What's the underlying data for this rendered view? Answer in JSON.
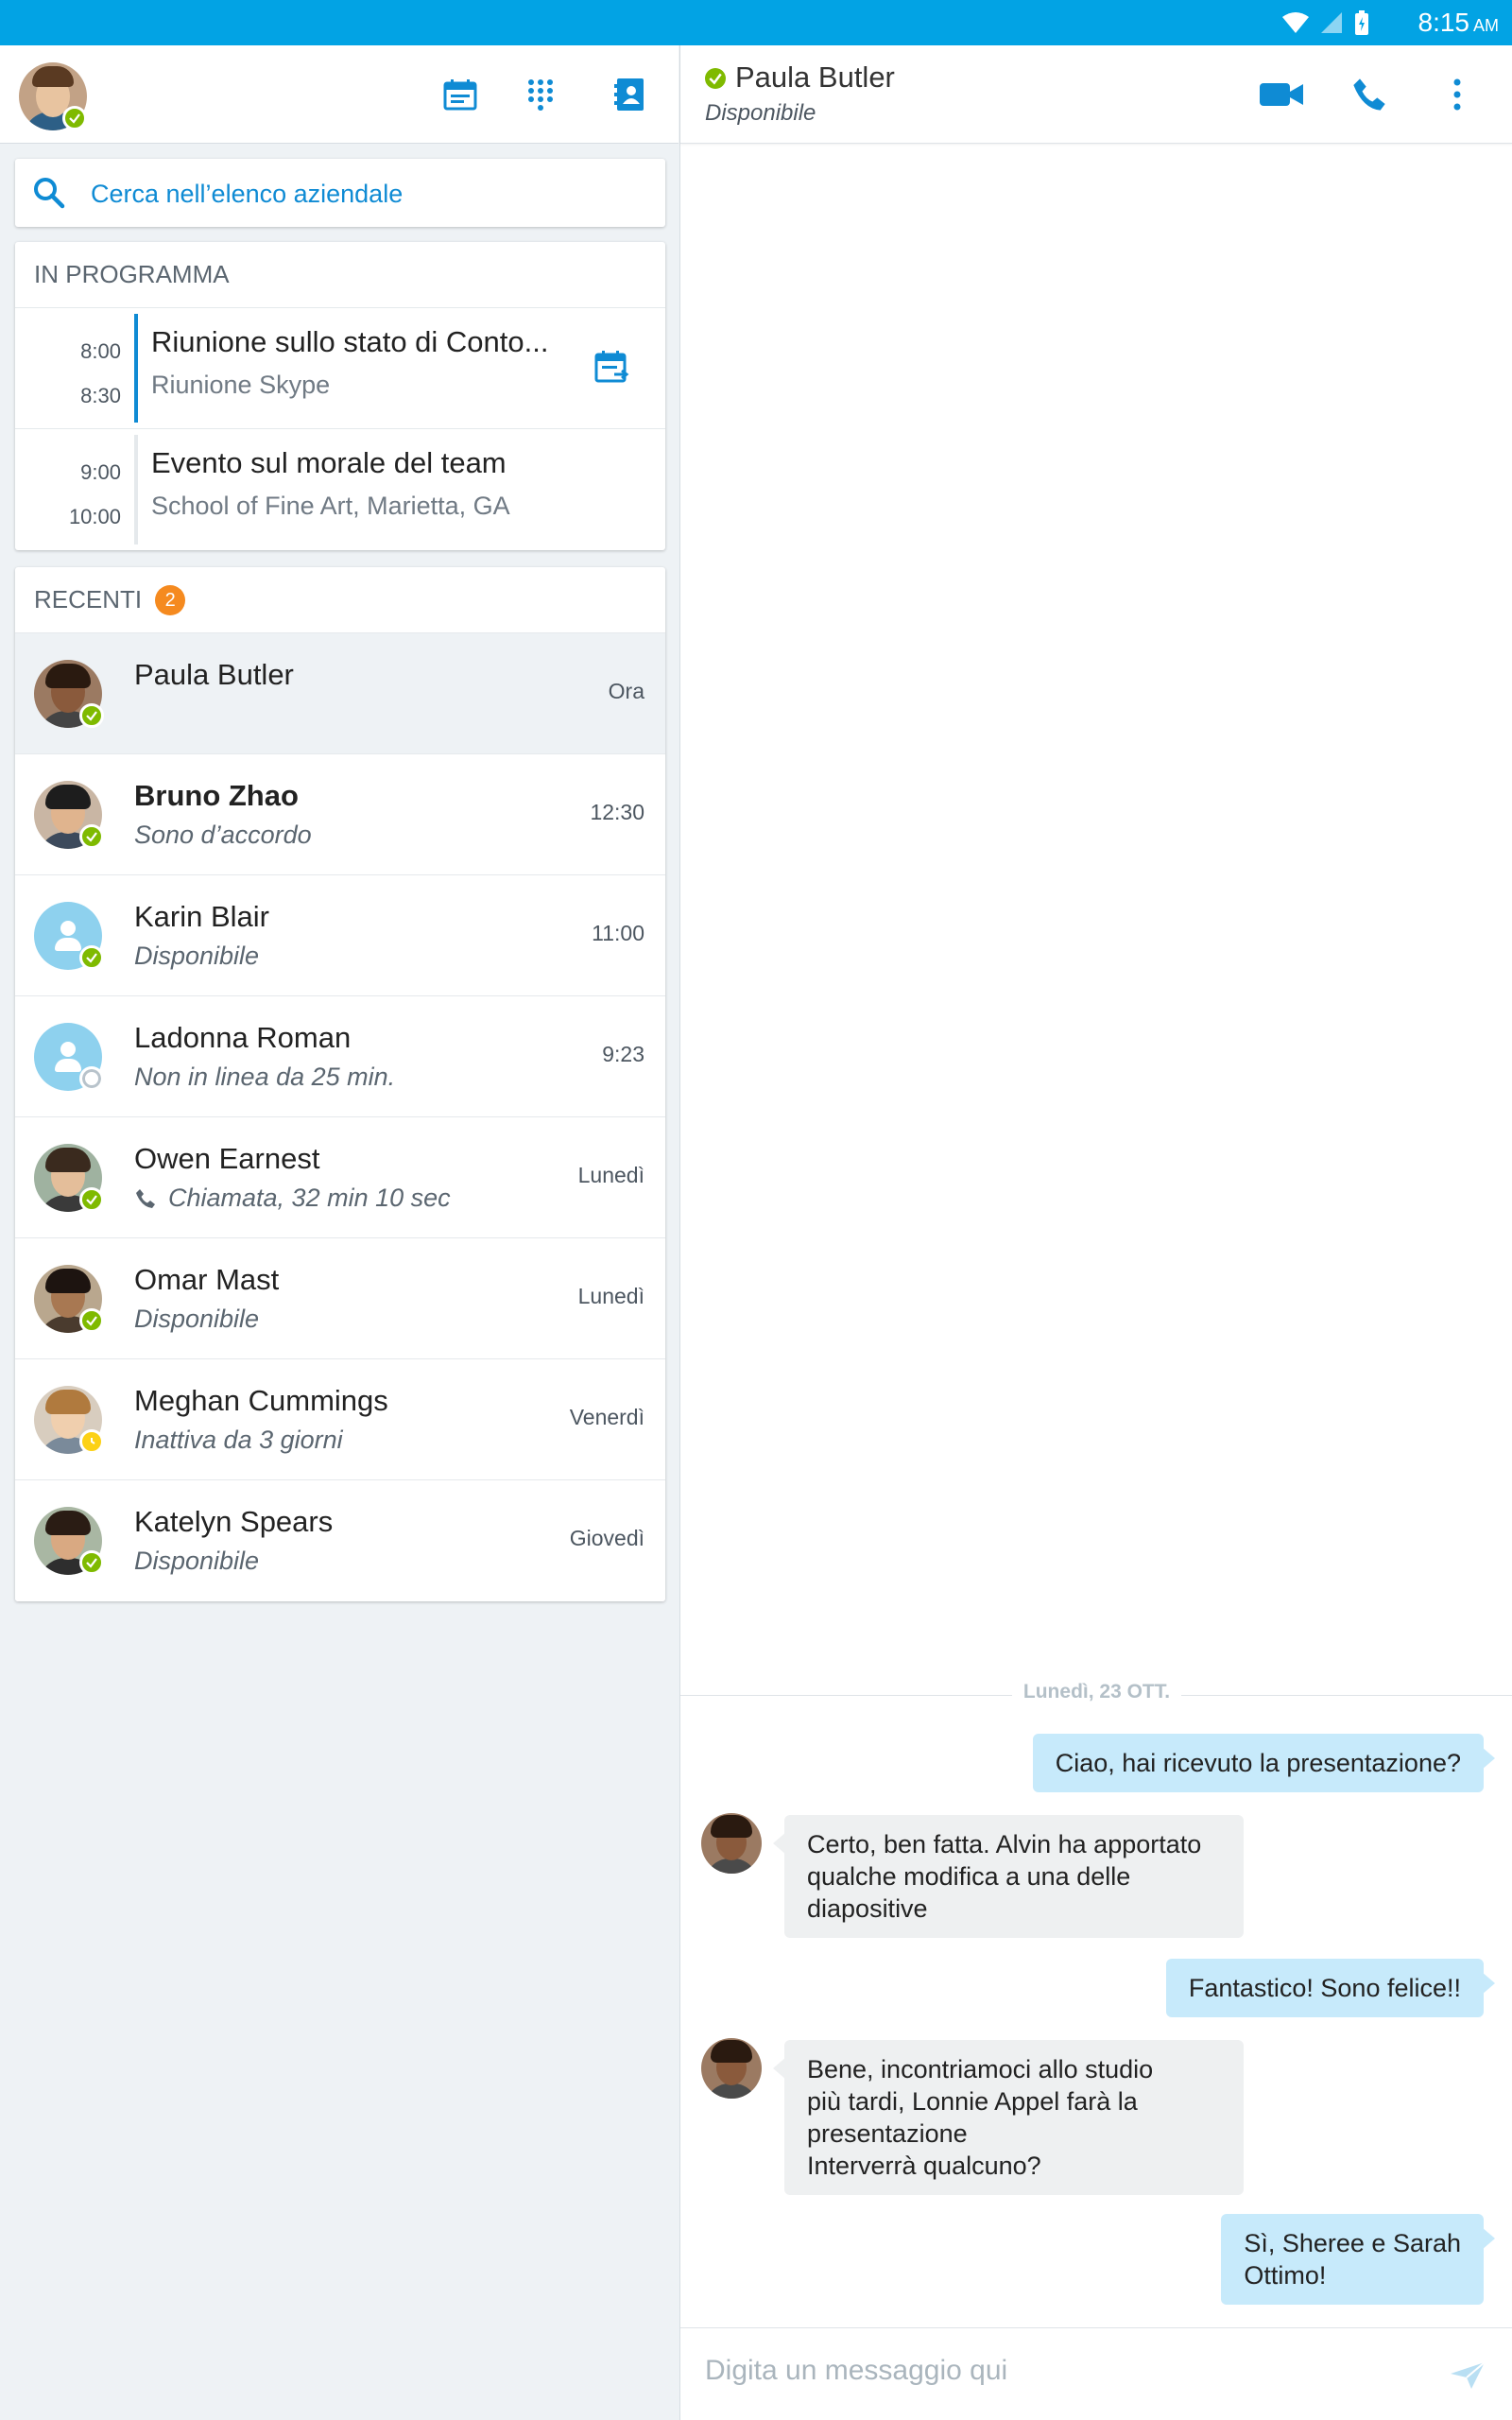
{
  "status_bar": {
    "time": "8:15",
    "ampm": "AM"
  },
  "colors": {
    "accent": "#02a3e4",
    "link": "#0f8bd4",
    "available": "#7fba00",
    "away": "#fcd116",
    "badge": "#f58a1f",
    "outgoing_bubble": "#c7eafb",
    "incoming_bubble": "#eef0f1"
  },
  "search": {
    "placeholder": "Cerca nell’elenco aziendale"
  },
  "schedule": {
    "header": "IN PROGRAMMA",
    "events": [
      {
        "start": "8:00",
        "end": "8:30",
        "title": "Riunione sullo stato di Conto...",
        "subtitle": "Riunione Skype"
      },
      {
        "start": "9:00",
        "end": "10:00",
        "title": "Evento sul morale del team",
        "subtitle": "School of Fine Art, Marietta, GA"
      }
    ]
  },
  "recents": {
    "header": "RECENTI",
    "badge": "2",
    "contacts": [
      {
        "name": "Paula Butler",
        "status": "",
        "time": "Ora",
        "presence": "available",
        "bold": false
      },
      {
        "name": "Bruno Zhao",
        "status": "Sono d’accordo",
        "time": "12:30",
        "presence": "available",
        "bold": true
      },
      {
        "name": "Karin Blair",
        "status": "Disponibile",
        "time": "11:00",
        "presence": "available",
        "bold": false
      },
      {
        "name": "Ladonna Roman",
        "status": "Non in linea da 25 min.",
        "time": "9:23",
        "presence": "offline",
        "bold": false
      },
      {
        "name": "Owen Earnest",
        "status": "Chiamata, 32 min 10 sec",
        "time": "Lunedì",
        "presence": "available",
        "bold": false,
        "icon": "phone-icon"
      },
      {
        "name": "Omar Mast",
        "status": "Disponibile",
        "time": "Lunedì",
        "presence": "available",
        "bold": false
      },
      {
        "name": "Meghan Cummings",
        "status": "Inattiva da 3 giorni",
        "time": "Venerdì",
        "presence": "away",
        "bold": false
      },
      {
        "name": "Katelyn Spears",
        "status": "Disponibile",
        "time": "Giovedì",
        "presence": "available",
        "bold": false
      }
    ]
  },
  "conversation": {
    "contact_name": "Paula Butler",
    "contact_status": "Disponibile",
    "date_separator": "Lunedì, 23 OTT.",
    "messages": [
      {
        "direction": "out",
        "lines": [
          "Ciao, hai ricevuto la presentazione?"
        ]
      },
      {
        "direction": "in",
        "lines": [
          "Certo, ben fatta. Alvin ha apportato",
          "qualche modifica a una delle",
          "diapositive"
        ]
      },
      {
        "direction": "out",
        "lines": [
          "Fantastico! Sono felice!!"
        ]
      },
      {
        "direction": "in",
        "lines": [
          "Bene, incontriamoci allo studio",
          "più tardi, Lonnie Appel farà la",
          "presentazione",
          "Interverrà qualcuno?"
        ]
      },
      {
        "direction": "out",
        "lines": [
          "Sì, Sheree e Sarah",
          "Ottimo!"
        ]
      }
    ],
    "composer_placeholder": "Digita un messaggio qui"
  }
}
